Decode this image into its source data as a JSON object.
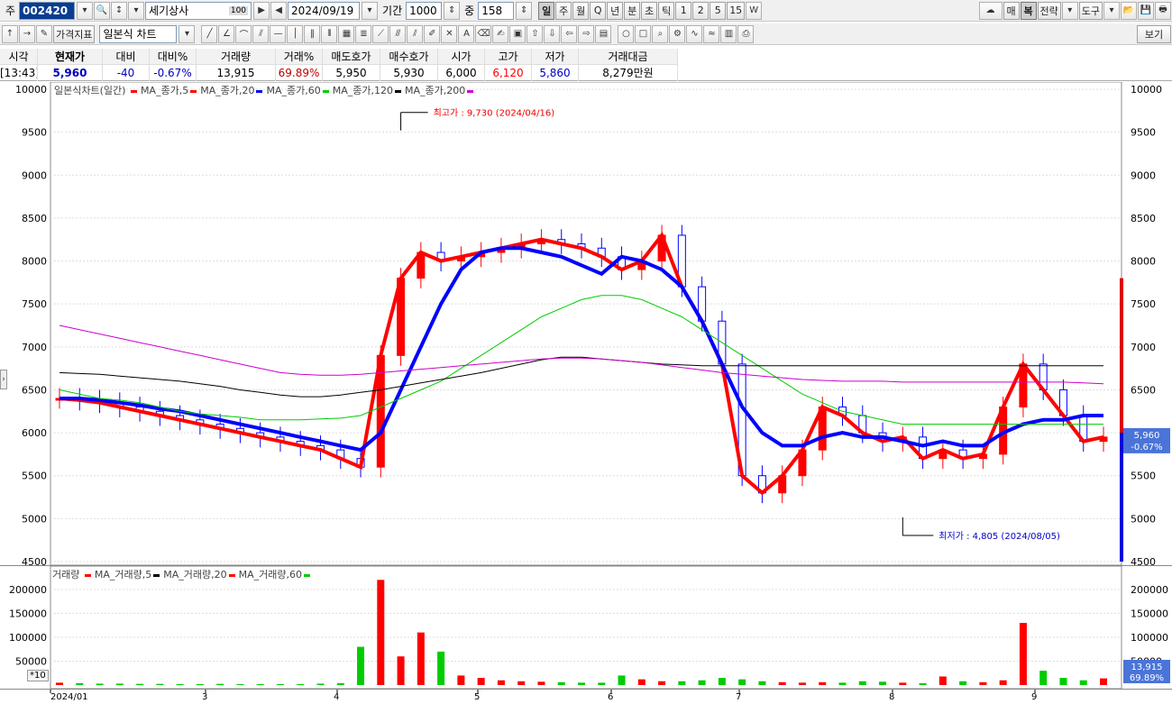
{
  "toolbar": {
    "code_prefix": "주",
    "stock_code": "002420",
    "stock_name": "세기상사",
    "name_badge": "100",
    "date": "2024/09/19",
    "period_label": "기간",
    "period_value": "1000",
    "zoom_label": "중",
    "zoom_value": "158",
    "periods": [
      "일",
      "주",
      "월",
      "Q",
      "년",
      "분",
      "초",
      "틱",
      "1",
      "2",
      "5",
      "15"
    ],
    "active_period": "일",
    "right_buttons": [
      "매",
      "복",
      "전략",
      "도구"
    ]
  },
  "toolbar2": {
    "indicator_btn": "가격지표",
    "chart_type": "일본식 차트",
    "view_btn": "보기"
  },
  "quote": {
    "headers": [
      "시각",
      "현재가",
      "대비",
      "대비%",
      "거래량",
      "거래%",
      "매도호가",
      "매수호가",
      "시가",
      "고가",
      "저가",
      "거래대금"
    ],
    "values": [
      "[13:43]",
      "5,960",
      "-40",
      "-0.67%",
      "13,915",
      "69.89%",
      "5,950",
      "5,930",
      "6,000",
      "6,120",
      "5,860",
      "8,279만원"
    ]
  },
  "price_legend": {
    "title": "일본식차트(일간)",
    "items": [
      {
        "label": "MA_종가,5",
        "color": "#ff0000"
      },
      {
        "label": "MA_종가,20",
        "color": "#ff0000"
      },
      {
        "label": "MA_종가,60",
        "color": "#0000ff"
      },
      {
        "label": "MA_종가,120",
        "color": "#00cc00"
      },
      {
        "label": "MA_종가,200",
        "color": "#000000"
      },
      {
        "label": "",
        "color": "#cc00cc"
      }
    ]
  },
  "volume_legend": {
    "title": "거래량",
    "items": [
      {
        "label": "MA_거래량,5",
        "color": "#ff0000"
      },
      {
        "label": "MA_거래량,20",
        "color": "#000000"
      },
      {
        "label": "MA_거래량,60",
        "color": "#ff0000"
      },
      {
        "label": "",
        "color": "#00cc00"
      }
    ]
  },
  "annotations": {
    "high": "최고가 : 9,730 (2024/04/16)",
    "low": "최저가 : 4,805 (2024/08/05)"
  },
  "price_tag": {
    "value": "5,960",
    "change": "-0.67%"
  },
  "volume_tag": {
    "value": "13,915",
    "pct": "69.89%"
  },
  "volume_unit": "*10",
  "colors": {
    "up": "#ff0000",
    "down": "#0000ff",
    "ma5": "#ff0000",
    "ma60": "#0000ff",
    "ma120": "#00cc00",
    "ma200": "#000000",
    "ma_extra": "#cc00cc"
  },
  "chart_data": [
    {
      "type": "candlestick",
      "ylim": [
        4500,
        10000
      ],
      "yticks": [
        10000,
        9500,
        9000,
        8500,
        8000,
        7500,
        7000,
        6500,
        6000,
        5500,
        5000,
        4500
      ],
      "x_labels": [
        "2024/01",
        "3",
        "4",
        "5",
        "6",
        "7",
        "8",
        "9"
      ],
      "high": {
        "value": 9730,
        "date": "2024/04/16"
      },
      "low": {
        "value": 4805,
        "date": "2024/08/05"
      },
      "series": [
        {
          "name": "MA_종가,5",
          "values": [
            6400,
            6380,
            6350,
            6300,
            6250,
            6200,
            6150,
            6100,
            6050,
            6000,
            5950,
            5900,
            5850,
            5800,
            5700,
            5600,
            6900,
            7800,
            8100,
            8000,
            8050,
            8100,
            8150,
            8200,
            8250,
            8200,
            8150,
            8050,
            7900,
            8000,
            8300,
            7700,
            7300,
            6800,
            5500,
            5300,
            5500,
            5800,
            6300,
            6200,
            6000,
            5900,
            5950,
            5700,
            5800,
            5700,
            5750,
            6300,
            6800,
            6500,
            6200,
            5900,
            5950
          ]
        },
        {
          "name": "MA_종가,60",
          "values": [
            6400,
            6400,
            6380,
            6350,
            6320,
            6280,
            6250,
            6200,
            6150,
            6100,
            6050,
            6000,
            5950,
            5900,
            5850,
            5800,
            6000,
            6500,
            7000,
            7500,
            7900,
            8100,
            8150,
            8150,
            8100,
            8050,
            7950,
            7850,
            8050,
            8000,
            7900,
            7700,
            7300,
            6800,
            6300,
            6000,
            5850,
            5850,
            5950,
            6000,
            5950,
            5950,
            5900,
            5850,
            5900,
            5850,
            5850,
            6000,
            6100,
            6150,
            6150,
            6200,
            6200
          ]
        },
        {
          "name": "MA_종가,120",
          "values": [
            6500,
            6450,
            6400,
            6380,
            6350,
            6300,
            6250,
            6220,
            6200,
            6180,
            6150,
            6150,
            6150,
            6160,
            6170,
            6200,
            6300,
            6400,
            6500,
            6600,
            6750,
            6900,
            7050,
            7200,
            7350,
            7450,
            7550,
            7600,
            7600,
            7550,
            7450,
            7350,
            7200,
            7050,
            6900,
            6750,
            6600,
            6450,
            6350,
            6250,
            6200,
            6150,
            6100,
            6100,
            6100,
            6100,
            6100,
            6100,
            6100,
            6100,
            6100,
            6100,
            6100
          ]
        },
        {
          "name": "MA_종가,200",
          "values": [
            6700,
            6690,
            6680,
            6660,
            6640,
            6620,
            6600,
            6570,
            6540,
            6500,
            6470,
            6440,
            6420,
            6420,
            6440,
            6470,
            6500,
            6540,
            6580,
            6620,
            6660,
            6700,
            6750,
            6800,
            6850,
            6880,
            6880,
            6860,
            6840,
            6820,
            6800,
            6790,
            6780,
            6780,
            6780,
            6780,
            6780,
            6780,
            6780,
            6780,
            6780,
            6780,
            6780,
            6780,
            6780,
            6780,
            6780,
            6780,
            6780,
            6780,
            6780,
            6780,
            6780
          ]
        },
        {
          "name": "",
          "values": [
            7250,
            7200,
            7150,
            7100,
            7050,
            7000,
            6950,
            6900,
            6850,
            6800,
            6750,
            6700,
            6680,
            6670,
            6670,
            6680,
            6700,
            6720,
            6740,
            6760,
            6780,
            6800,
            6820,
            6840,
            6860,
            6870,
            6870,
            6860,
            6840,
            6820,
            6790,
            6760,
            6730,
            6700,
            6680,
            6660,
            6640,
            6620,
            6610,
            6600,
            6600,
            6600,
            6590,
            6590,
            6590,
            6590,
            6590,
            6590,
            6590,
            6590,
            6590,
            6580,
            6570
          ]
        }
      ]
    },
    {
      "type": "bar",
      "ylim": [
        0,
        230000
      ],
      "yticks": [
        200000,
        150000,
        100000,
        50000
      ],
      "series": [
        {
          "name": "거래량",
          "values": [
            5000,
            4000,
            3000,
            3000,
            2500,
            2500,
            2000,
            2000,
            2500,
            2000,
            2000,
            2000,
            2000,
            3000,
            4000,
            80000,
            220000,
            60000,
            110000,
            70000,
            20000,
            15000,
            10000,
            8000,
            7000,
            6000,
            5000,
            5000,
            20000,
            12000,
            8000,
            8000,
            10000,
            15000,
            12000,
            8000,
            6000,
            5000,
            6000,
            5000,
            8000,
            7000,
            5000,
            4000,
            18000,
            8000,
            6000,
            10000,
            130000,
            30000,
            15000,
            10000,
            14000
          ]
        }
      ]
    }
  ]
}
